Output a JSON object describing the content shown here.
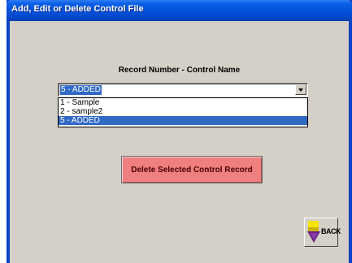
{
  "window": {
    "title": "Add, Edit or Delete Control File"
  },
  "main": {
    "heading": "Record Number - Control Name",
    "select": {
      "value": "5 - ADDED",
      "options": [
        "1 - Sample",
        "2 - sample2",
        "5 - ADDED"
      ],
      "selected_index": 2
    },
    "delete_button_label": "Delete Selected Control Record",
    "back_button": {
      "label": "BACK",
      "icon": "back-arrow-icon"
    }
  },
  "colors": {
    "titlebar": "#0351d8",
    "window_bg": "#d4d0c8",
    "selection": "#316ac5",
    "delete_button": "#f08080",
    "back_icon_yellow": "#f5e500",
    "back_icon_purple": "#6a1e86"
  }
}
